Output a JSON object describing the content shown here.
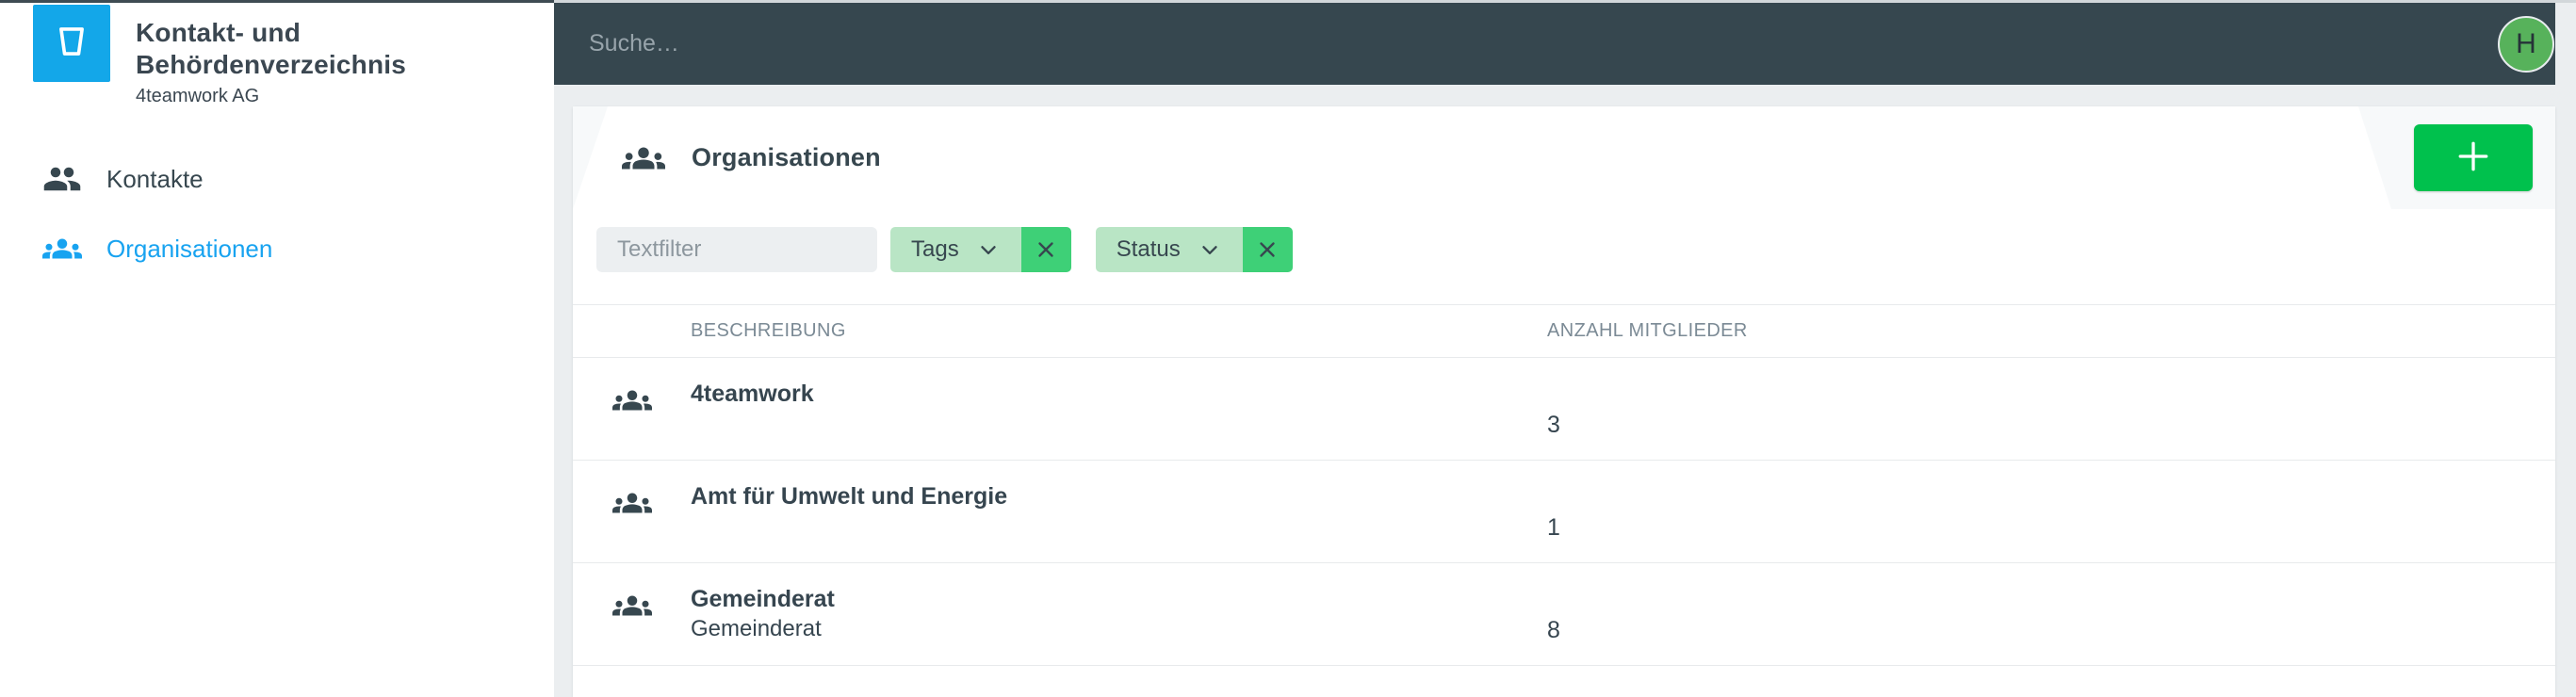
{
  "sidebar": {
    "app_title": "Kontakt- und Behördenverzeichnis",
    "app_subtitle": "4teamwork AG",
    "items": [
      {
        "label": "Kontakte",
        "icon": "people-icon",
        "active": false
      },
      {
        "label": "Organisationen",
        "icon": "groups-icon",
        "active": true
      }
    ]
  },
  "topbar": {
    "search_placeholder": "Suche…",
    "avatar_initial": "H"
  },
  "main": {
    "title": "Organisationen",
    "add_button": "+",
    "filters": {
      "text_placeholder": "Textfilter",
      "chips": [
        {
          "label": "Tags"
        },
        {
          "label": "Status"
        }
      ]
    },
    "table": {
      "columns": [
        "Beschreibung",
        "Anzahl Mitglieder"
      ],
      "rows": [
        {
          "title": "4teamwork",
          "subtitle": "",
          "members": "3"
        },
        {
          "title": "Amt für Umwelt und Energie",
          "subtitle": "",
          "members": "1"
        },
        {
          "title": "Gemeinderat",
          "subtitle": "Gemeinderat",
          "members": "8"
        }
      ]
    }
  },
  "colors": {
    "brand_blue": "#13a7e9",
    "active_link_blue": "#18a3f0",
    "topbar_dark": "#36474f",
    "page_background": "#ebeef0",
    "add_button_green": "#00c14d",
    "chip_green_light": "#b9e5c5",
    "chip_green_dark": "#3ed077",
    "avatar_green": "#57b25b",
    "text_dark": "#37474f"
  }
}
